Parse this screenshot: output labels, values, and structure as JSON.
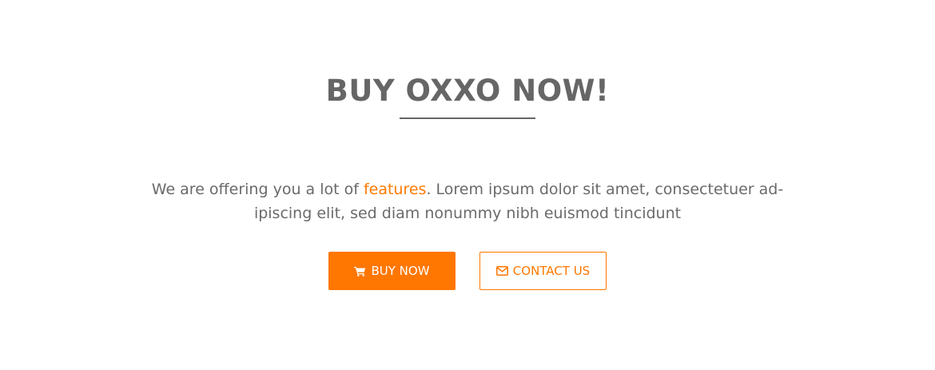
{
  "hero": {
    "title": "BUY OXXO NOW!",
    "lead_before": "We are offering you a lot of ",
    "lead_link": "features",
    "lead_after": ". Lorem ipsum dolor sit amet, consectetuer ad-ipiscing elit, sed diam nonummy nibh euismod tincidunt"
  },
  "buttons": {
    "buy_label": "BUY NOW",
    "buy_icon": "shopping-cart-icon",
    "contact_label": "CONTACT US",
    "contact_icon": "envelope-icon"
  },
  "colors": {
    "accent": "#ff7700",
    "heading": "#666666",
    "text": "#6a6a6a",
    "background": "#ffffff"
  }
}
